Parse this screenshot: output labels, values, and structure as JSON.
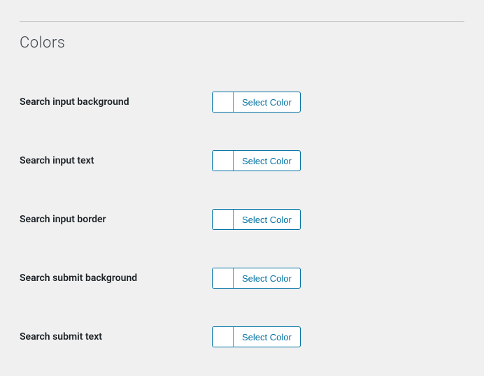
{
  "section": {
    "title": "Colors"
  },
  "rows": [
    {
      "label": "Search input background",
      "button": "Select Color"
    },
    {
      "label": "Search input text",
      "button": "Select Color"
    },
    {
      "label": "Search input border",
      "button": "Select Color"
    },
    {
      "label": "Search submit background",
      "button": "Select Color"
    },
    {
      "label": "Search submit text",
      "button": "Select Color"
    }
  ]
}
